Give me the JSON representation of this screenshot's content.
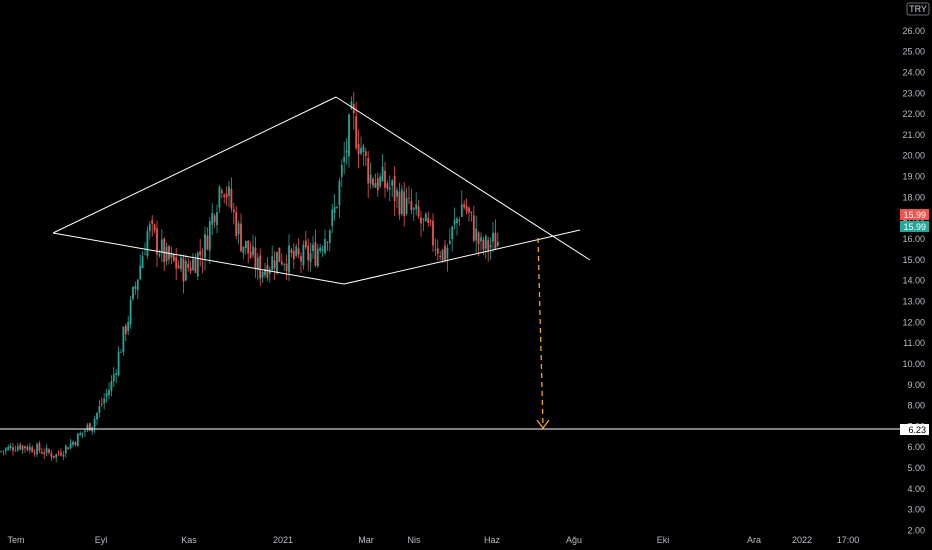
{
  "chart_data": {
    "type": "candlestick",
    "currency": "TRY",
    "last_price": "15.99",
    "last_price_label_2": "15.99",
    "support_level_label": "6.23",
    "support_level": 6.23,
    "y_ticks": [
      "2.00",
      "3.00",
      "4.00",
      "5.00",
      "6.00",
      "7.00",
      "8.00",
      "9.00",
      "10.00",
      "11.00",
      "12.00",
      "13.00",
      "14.00",
      "15.00",
      "16.00",
      "17.00",
      "18.00",
      "19.00",
      "20.00",
      "21.00",
      "22.00",
      "23.00",
      "24.00",
      "25.00",
      "26.00"
    ],
    "y_tick_values": [
      2,
      3,
      4,
      5,
      6,
      7,
      8,
      9,
      10,
      11,
      12,
      13,
      14,
      15,
      16,
      17,
      18,
      19,
      20,
      21,
      22,
      23,
      24,
      25,
      26
    ],
    "ylim": [
      1.3,
      26.6
    ],
    "x_ticks": [
      "Tem",
      "Eyl",
      "Kas",
      "2021",
      "Mar",
      "Nis",
      "Haz",
      "Ağu",
      "Eki",
      "Ara",
      "2022",
      "17:00"
    ],
    "colors": {
      "up": "#26a69a",
      "down": "#ef5350",
      "line": "#ffffff",
      "arrow": "#f5a623",
      "background": "#000000"
    },
    "price_path": [
      {
        "t": "Tem",
        "v": 5.8
      },
      {
        "t": "Tem+",
        "v": 6.1
      },
      {
        "t": "Ağu-",
        "v": 5.9
      },
      {
        "t": "Ağu",
        "v": 5.6
      },
      {
        "t": "Ağu+",
        "v": 6.3
      },
      {
        "t": "Eyl-",
        "v": 7.2
      },
      {
        "t": "Eyl",
        "v": 9.0
      },
      {
        "t": "Eyl+",
        "v": 12.5
      },
      {
        "t": "Eki-",
        "v": 16.5
      },
      {
        "t": "Eki",
        "v": 15.0
      },
      {
        "t": "Eki+",
        "v": 14.5
      },
      {
        "t": "Kas-",
        "v": 15.5
      },
      {
        "t": "Kas",
        "v": 19.0
      },
      {
        "t": "Kas+",
        "v": 16.0
      },
      {
        "t": "Ara",
        "v": 14.5
      },
      {
        "t": "Ara+",
        "v": 15.2
      },
      {
        "t": "2021",
        "v": 15.0
      },
      {
        "t": "2021+",
        "v": 15.3
      },
      {
        "t": "Şub-",
        "v": 17.0
      },
      {
        "t": "Şub",
        "v": 21.8
      },
      {
        "t": "Şub+",
        "v": 19.0
      },
      {
        "t": "Mar",
        "v": 18.5
      },
      {
        "t": "Mar+",
        "v": 17.5
      },
      {
        "t": "Nis",
        "v": 16.5
      },
      {
        "t": "Nis+",
        "v": 15.2
      },
      {
        "t": "May",
        "v": 17.8
      },
      {
        "t": "May+",
        "v": 15.5
      },
      {
        "t": "Haz",
        "v": 15.99
      }
    ]
  }
}
